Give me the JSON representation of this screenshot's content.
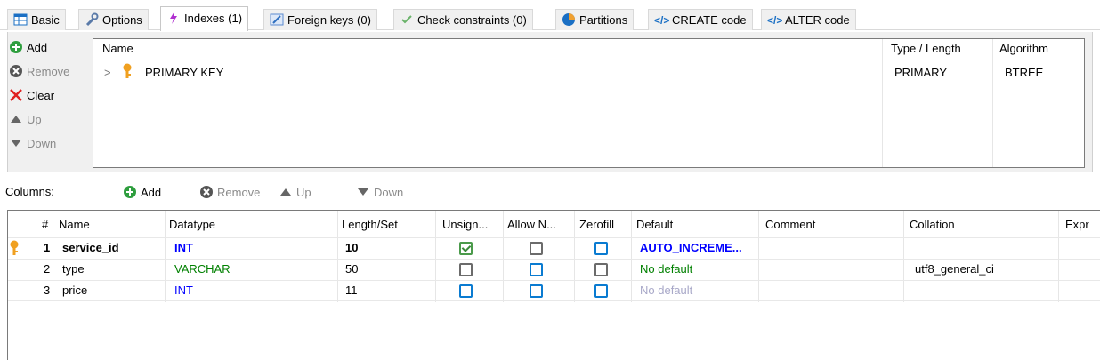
{
  "tabs": [
    {
      "label": "Basic",
      "icon": "table-icon"
    },
    {
      "label": "Options",
      "icon": "wrench-icon"
    },
    {
      "label": "Indexes (1)",
      "icon": "lightning-icon"
    },
    {
      "label": "Foreign keys (0)",
      "icon": "foreign-key-icon"
    },
    {
      "label": "Check constraints (0)",
      "icon": "check-icon"
    },
    {
      "label": "Partitions",
      "icon": "pie-icon"
    },
    {
      "label": "CREATE code",
      "icon": "code-icon"
    },
    {
      "label": "ALTER code",
      "icon": "code-icon"
    }
  ],
  "index_buttons": {
    "add": "Add",
    "remove": "Remove",
    "clear": "Clear",
    "up": "Up",
    "down": "Down"
  },
  "index_grid": {
    "headers": {
      "name": "Name",
      "type": "Type / Length",
      "algorithm": "Algorithm"
    },
    "rows": [
      {
        "expand": ">",
        "name": "PRIMARY KEY",
        "type": "PRIMARY",
        "algorithm": "BTREE"
      }
    ]
  },
  "columns_toolbar": {
    "label": "Columns:",
    "add": "Add",
    "remove": "Remove",
    "up": "Up",
    "down": "Down"
  },
  "columns_grid": {
    "headers": {
      "num": "#",
      "name": "Name",
      "datatype": "Datatype",
      "length": "Length/Set",
      "unsigned": "Unsign...",
      "allow_null": "Allow N...",
      "zerofill": "Zerofill",
      "default": "Default",
      "comment": "Comment",
      "collation": "Collation",
      "expr": "Expr"
    },
    "rows": [
      {
        "num": "1",
        "name": "service_id",
        "datatype": "INT",
        "length": "10",
        "unsigned": true,
        "allow_null": false,
        "zerofill": false,
        "default": "AUTO_INCREME...",
        "comment": "",
        "collation": ""
      },
      {
        "num": "2",
        "name": "type",
        "datatype": "VARCHAR",
        "length": "50",
        "unsigned": false,
        "allow_null": false,
        "zerofill": false,
        "default": "No default",
        "comment": "",
        "collation": "utf8_general_ci"
      },
      {
        "num": "3",
        "name": "price",
        "datatype": "INT",
        "length": "11",
        "unsigned": false,
        "allow_null": false,
        "zerofill": false,
        "default": "No default",
        "comment": "",
        "collation": ""
      }
    ]
  },
  "colors": {
    "int": "#0000ff",
    "varchar": "#008000",
    "accent": "#0a7bd1"
  }
}
